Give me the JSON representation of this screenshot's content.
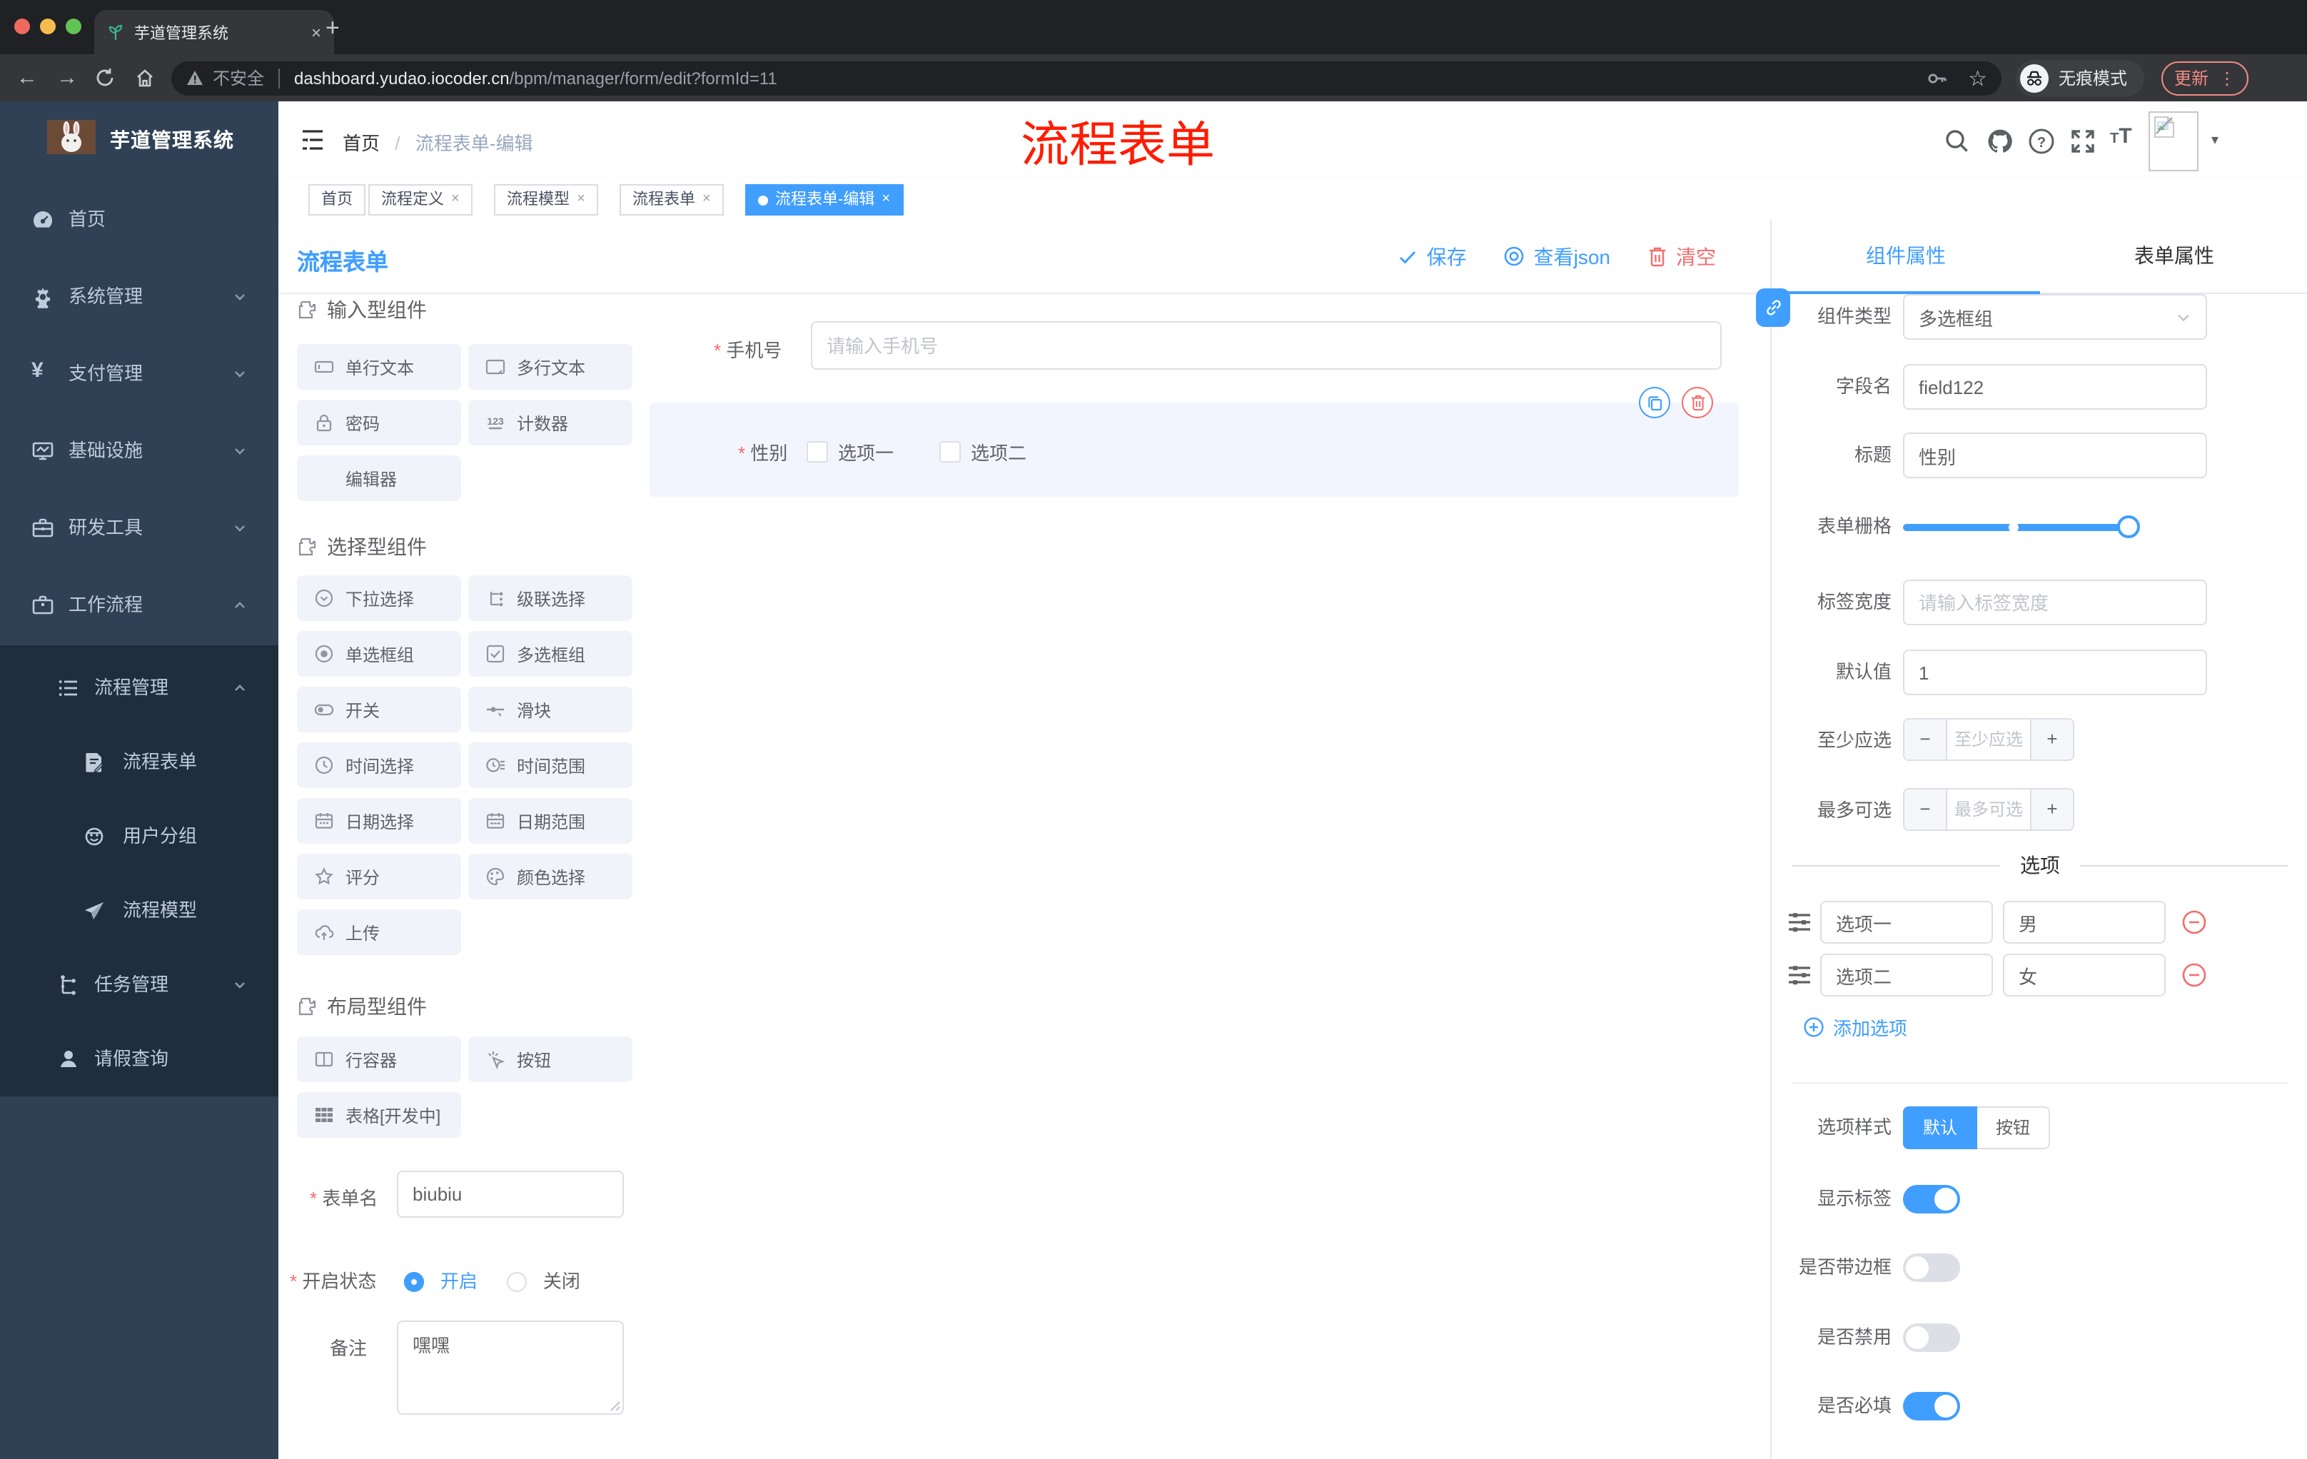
{
  "colors": {
    "primary": "#409eff",
    "danger": "#f56c6c",
    "annotation_red": "#fe1c03",
    "sidebar_bg": "#304156",
    "sidebar_submenu_bg": "#1f2d3d",
    "active_tag": "#409eff"
  },
  "icons": {
    "close": "×",
    "plus": "+",
    "back": "←",
    "forward": "→",
    "caret": "▾",
    "dots": "⋮",
    "star": "☆",
    "question": "?",
    "slash": "/"
  },
  "browser": {
    "tab_title": "芋道管理系统",
    "security_label": "不安全",
    "url_host": "dashboard.yudao.iocoder.cn",
    "url_path": "/bpm/manager/form/edit?formId=11",
    "incognito_label": "无痕模式",
    "update_label": "更新"
  },
  "sidebar": {
    "logo_title": "芋道管理系统",
    "items": [
      {
        "label": "首页",
        "icon": "dashboard-icon"
      },
      {
        "label": "系统管理",
        "icon": "gear-icon"
      },
      {
        "label": "支付管理",
        "icon": "yen-icon"
      },
      {
        "label": "基础设施",
        "icon": "monitor-icon"
      },
      {
        "label": "研发工具",
        "icon": "toolbox-icon"
      },
      {
        "label": "工作流程",
        "icon": "briefcase-icon"
      }
    ],
    "submenu": [
      {
        "label": "流程管理",
        "icon": "list-icon"
      },
      {
        "label": "流程表单",
        "icon": "form-icon"
      },
      {
        "label": "用户分组",
        "icon": "group-icon"
      },
      {
        "label": "流程模型",
        "icon": "model-icon"
      },
      {
        "label": "任务管理",
        "icon": "tree-icon"
      },
      {
        "label": "请假查询",
        "icon": "user-icon"
      }
    ]
  },
  "header": {
    "breadcrumb": {
      "home": "首页",
      "separator": "/",
      "current": "流程表单-编辑"
    },
    "annotation": "流程表单"
  },
  "tags": [
    {
      "label": "首页"
    },
    {
      "label": "流程定义"
    },
    {
      "label": "流程模型"
    },
    {
      "label": "流程表单"
    },
    {
      "label": "流程表单-编辑"
    }
  ],
  "designer": {
    "panel_title": "流程表单",
    "toolbar": {
      "save": "保存",
      "view_json": "查看json",
      "clear": "清空"
    },
    "palette": {
      "section1": {
        "title": "输入型组件",
        "items": [
          "单行文本",
          "多行文本",
          "密码",
          "计数器",
          "编辑器"
        ]
      },
      "section2": {
        "title": "选择型组件",
        "items": [
          "下拉选择",
          "级联选择",
          "单选框组",
          "多选框组",
          "开关",
          "滑块",
          "时间选择",
          "时间范围",
          "日期选择",
          "日期范围",
          "评分",
          "颜色选择",
          "上传"
        ]
      },
      "section3": {
        "title": "布局型组件",
        "items": [
          "行容器",
          "按钮",
          "表格[开发中]"
        ]
      }
    },
    "meta": {
      "name_label": "表单名",
      "name_value": "biubiu",
      "status_label": "开启状态",
      "status_on": "开启",
      "status_off": "关闭",
      "remark_label": "备注",
      "remark_value": "嘿嘿"
    },
    "canvas": {
      "phone_label": "手机号",
      "phone_placeholder": "请输入手机号",
      "gender_label": "性别",
      "gender_option1": "选项一",
      "gender_option2": "选项二"
    }
  },
  "props": {
    "tab_component": "组件属性",
    "tab_form": "表单属性",
    "type_label": "组件类型",
    "type_value": "多选框组",
    "field_label": "字段名",
    "field_value": "field122",
    "title_label": "标题",
    "title_value": "性别",
    "grid_label": "表单栅格",
    "label_width_label": "标签宽度",
    "label_width_placeholder": "请输入标签宽度",
    "default_label": "默认值",
    "default_value": "1",
    "min_label": "至少应选",
    "min_placeholder": "至少应选",
    "max_label": "最多可选",
    "max_placeholder": "最多可选",
    "options_title": "选项",
    "options": [
      {
        "label": "选项一",
        "value": "男"
      },
      {
        "label": "选项二",
        "value": "女"
      }
    ],
    "add_option": "添加选项",
    "style_label": "选项样式",
    "style_default": "默认",
    "style_button": "按钮",
    "show_label_label": "显示标签",
    "show_label_on": true,
    "border_label": "是否带边框",
    "border_on": false,
    "disabled_label": "是否禁用",
    "disabled_on": false,
    "required_label": "是否必填",
    "required_on": true
  }
}
